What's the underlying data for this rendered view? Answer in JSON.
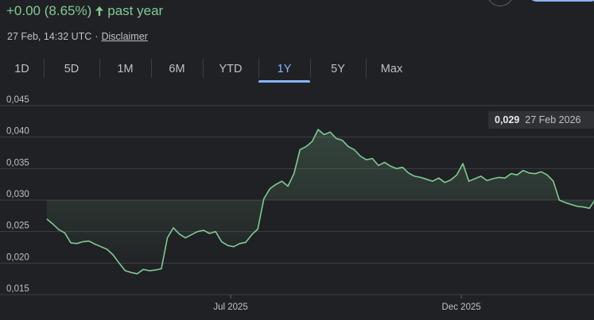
{
  "header": {
    "change_text": "+0.00 (8.65%)",
    "period_text": "past year",
    "arrow_icon": "arrow-up-icon",
    "timestamp": "27 Feb, 14:32 UTC",
    "separator": "·",
    "disclaimer": "Disclaimer"
  },
  "tabs": [
    {
      "label": "1D",
      "active": false
    },
    {
      "label": "5D",
      "active": false
    },
    {
      "label": "1M",
      "active": false
    },
    {
      "label": "6M",
      "active": false
    },
    {
      "label": "YTD",
      "active": false
    },
    {
      "label": "1Y",
      "active": true
    },
    {
      "label": "5Y",
      "active": false
    },
    {
      "label": "Max",
      "active": false
    }
  ],
  "tooltip": {
    "value": "0,029",
    "date": "27 Feb 2026"
  },
  "colors": {
    "background": "#202124",
    "line": "#81c995",
    "positive": "#81c995",
    "active_tab": "#8ab4f8",
    "gridline": "#3c4043",
    "text": "#bdc1c6"
  },
  "chart_data": {
    "type": "area",
    "title": "",
    "xlabel": "",
    "ylabel": "",
    "ylim": [
      0.015,
      0.045
    ],
    "xlim": [
      "2025-02-27",
      "2026-02-27"
    ],
    "grid": true,
    "y_ticks": [
      {
        "value": 0.045,
        "label": "0,045"
      },
      {
        "value": 0.04,
        "label": "0,040"
      },
      {
        "value": 0.035,
        "label": "0,035"
      },
      {
        "value": 0.03,
        "label": "0,030"
      },
      {
        "value": 0.025,
        "label": "0,025"
      },
      {
        "value": 0.02,
        "label": "0,020"
      },
      {
        "value": 0.015,
        "label": "0,015"
      }
    ],
    "x_ticks": [
      {
        "date": "2025-07-01",
        "label": "Jul 2025"
      },
      {
        "date": "2025-12-01",
        "label": "Dec 2025"
      }
    ],
    "series": [
      {
        "x": [
          "2025-03-01",
          "2025-03-05",
          "2025-03-09",
          "2025-03-13",
          "2025-03-17",
          "2025-03-21",
          "2025-03-25",
          "2025-03-29",
          "2025-04-02",
          "2025-04-06",
          "2025-04-10",
          "2025-04-14",
          "2025-04-18",
          "2025-04-22",
          "2025-04-26",
          "2025-04-30",
          "2025-05-04",
          "2025-05-08",
          "2025-05-12",
          "2025-05-16",
          "2025-05-20",
          "2025-05-24",
          "2025-05-28",
          "2025-06-01",
          "2025-06-05",
          "2025-06-09",
          "2025-06-13",
          "2025-06-17",
          "2025-06-21",
          "2025-06-25",
          "2025-06-29",
          "2025-07-03",
          "2025-07-07",
          "2025-07-11",
          "2025-07-15",
          "2025-07-19",
          "2025-07-23",
          "2025-07-27",
          "2025-07-31",
          "2025-08-04",
          "2025-08-08",
          "2025-08-12",
          "2025-08-16",
          "2025-08-20",
          "2025-08-24",
          "2025-08-28",
          "2025-09-01",
          "2025-09-05",
          "2025-09-09",
          "2025-09-13",
          "2025-09-17",
          "2025-09-21",
          "2025-09-25",
          "2025-09-29",
          "2025-10-03",
          "2025-10-07",
          "2025-10-11",
          "2025-10-15",
          "2025-10-19",
          "2025-10-23",
          "2025-10-27",
          "2025-10-31",
          "2025-11-04",
          "2025-11-08",
          "2025-11-12",
          "2025-11-16",
          "2025-11-20",
          "2025-11-24",
          "2025-11-28",
          "2025-12-02",
          "2025-12-06",
          "2025-12-10",
          "2025-12-14",
          "2025-12-18",
          "2025-12-22",
          "2025-12-26",
          "2025-12-30",
          "2026-01-03",
          "2026-01-07",
          "2026-01-11",
          "2026-01-15",
          "2026-01-19",
          "2026-01-23",
          "2026-01-27",
          "2026-01-31",
          "2026-02-04",
          "2026-02-08",
          "2026-02-12",
          "2026-02-16",
          "2026-02-20",
          "2026-02-24",
          "2026-02-27"
        ],
        "values": [
          0.027,
          0.0262,
          0.0253,
          0.0248,
          0.0232,
          0.0231,
          0.0234,
          0.0235,
          0.023,
          0.0226,
          0.0222,
          0.0213,
          0.02,
          0.0188,
          0.0185,
          0.0183,
          0.019,
          0.0188,
          0.0189,
          0.0191,
          0.024,
          0.0256,
          0.0246,
          0.024,
          0.0245,
          0.025,
          0.0252,
          0.0247,
          0.025,
          0.0234,
          0.0228,
          0.0226,
          0.0231,
          0.0233,
          0.0245,
          0.0254,
          0.0302,
          0.0318,
          0.0325,
          0.033,
          0.0322,
          0.0342,
          0.038,
          0.0385,
          0.0393,
          0.0412,
          0.0404,
          0.0408,
          0.0398,
          0.0395,
          0.0385,
          0.038,
          0.037,
          0.0364,
          0.0366,
          0.0355,
          0.036,
          0.0354,
          0.035,
          0.0352,
          0.0343,
          0.0338,
          0.0336,
          0.0333,
          0.033,
          0.0335,
          0.0328,
          0.0332,
          0.034,
          0.0358,
          0.033,
          0.0334,
          0.0338,
          0.0331,
          0.0334,
          0.0336,
          0.0335,
          0.0342,
          0.034,
          0.0347,
          0.0343,
          0.0342,
          0.0345,
          0.034,
          0.033,
          0.03,
          0.0296,
          0.0293,
          0.029,
          0.0289,
          0.0287,
          0.0298
        ]
      }
    ]
  }
}
